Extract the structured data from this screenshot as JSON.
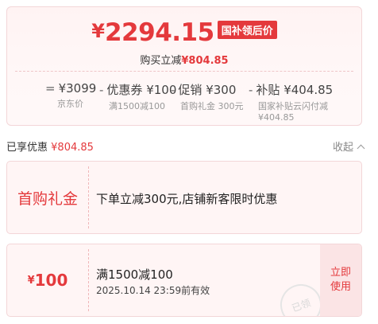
{
  "price": {
    "currency": "¥",
    "amount": "2294.15",
    "tag": "国补领后价",
    "reduce_label": "购买立减",
    "reduce_value": "¥804.85"
  },
  "formula": [
    {
      "op": "=",
      "value": "¥3099",
      "label": "京东价"
    },
    {
      "op": "-",
      "value": "优惠券 ¥100",
      "label": "满1500减100"
    },
    {
      "op": "-",
      "value": "促销 ¥300",
      "label": "首购礼金 300元"
    },
    {
      "op": "-",
      "value": "补贴 ¥404.85",
      "label": "国家补贴云闪付减 ¥404.85"
    }
  ],
  "applied": {
    "label": "已享优惠",
    "value": "¥804.85",
    "collapse": "收起"
  },
  "coupon_gift": {
    "name": "首购礼金",
    "desc": "下单立减300元,店铺新客限时优惠"
  },
  "coupon_discount": {
    "currency": "¥",
    "amount": "100",
    "title": "满1500减100",
    "time": "2025.10.14 23:59前有效",
    "button": "立即使用",
    "stamp": "已领"
  },
  "colors": {
    "accent": "#e4393c"
  }
}
